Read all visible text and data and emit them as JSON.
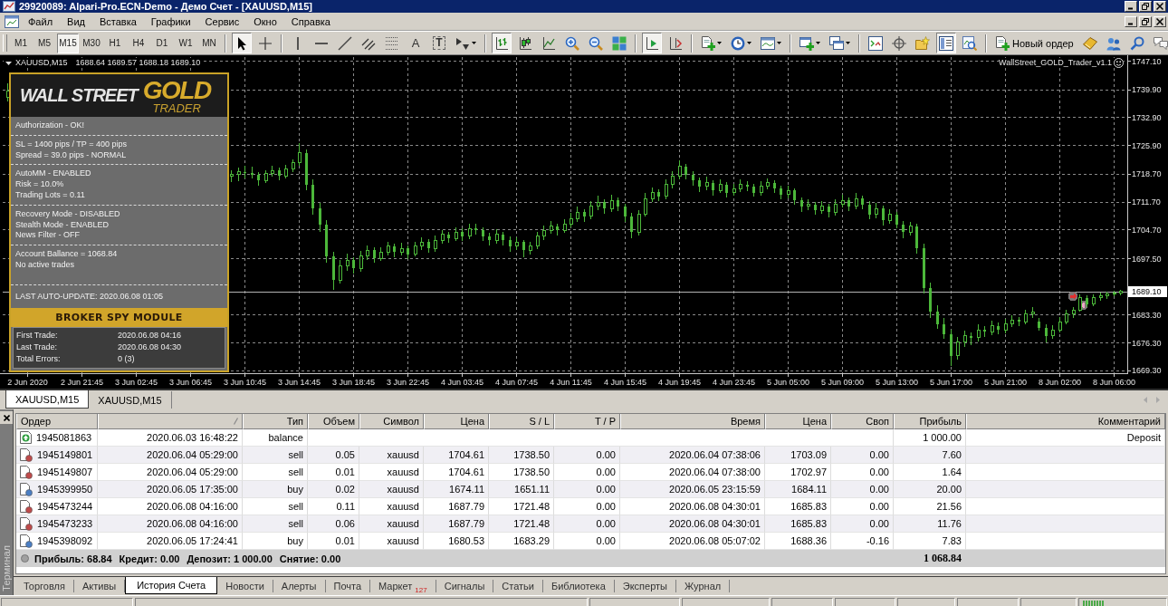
{
  "window": {
    "title": "29920089: Alpari-Pro.ECN-Demo - Демо Счет - [XAUUSD,M15]"
  },
  "menu": [
    "Файл",
    "Вид",
    "Вставка",
    "Графики",
    "Сервис",
    "Окно",
    "Справка"
  ],
  "toolbar": {
    "timeframes": [
      {
        "label": "M1",
        "selected": false
      },
      {
        "label": "M5",
        "selected": false
      },
      {
        "label": "M15",
        "selected": true
      },
      {
        "label": "M30",
        "selected": false
      },
      {
        "label": "H1",
        "selected": false
      },
      {
        "label": "H4",
        "selected": false
      },
      {
        "label": "D1",
        "selected": false
      },
      {
        "label": "W1",
        "selected": false
      },
      {
        "label": "MN",
        "selected": false
      }
    ],
    "groups": [
      [
        {
          "selected": true
        },
        {
          "selected": false
        }
      ],
      [
        {
          "selected": false
        },
        {
          "selected": false
        },
        {
          "selected": false
        },
        {
          "selected": false
        },
        {
          "selected": false
        },
        {
          "selected": false,
          "glyph": "A"
        },
        {
          "selected": false,
          "glyph": "T"
        },
        {
          "selected": false
        }
      ],
      [
        {
          "selected": true
        },
        {
          "selected": false
        },
        {
          "selected": false
        },
        {
          "selected": false
        },
        {
          "selected": false
        },
        {
          "selected": false
        }
      ],
      [
        {
          "selected": true
        },
        {
          "selected": false
        }
      ],
      [
        {
          "selected": false
        },
        {
          "selected": false
        },
        {
          "selected": false
        }
      ],
      [
        {
          "selected": false
        },
        {
          "selected": false
        }
      ],
      [
        {
          "selected": false
        },
        {
          "selected": false
        },
        {
          "selected": false
        },
        {
          "selected": true
        },
        {
          "selected": false
        }
      ],
      [
        {
          "selected": false,
          "label": "Новый ордер"
        },
        {
          "selected": false
        },
        {
          "selected": false
        },
        {
          "selected": false
        },
        {
          "selected": false
        }
      ]
    ]
  },
  "chart": {
    "symbol": "XAUUSD,M15",
    "quote": "1688.64 1689.57 1688.18 1689.10",
    "expert": "WallStreet_GOLD_Trader_v1.1",
    "expert_panel": {
      "logo": {
        "words": "WALL STREET",
        "highlight": "GOLD",
        "subtitle": "TRADER"
      },
      "sections": [
        [
          "Authorization - OK!"
        ],
        [
          "SL = 1400 pips / TP = 400 pips",
          "Spread = 39.0 pips - NORMAL"
        ],
        [
          "AutoMM - ENABLED",
          "Risk = 10.0%",
          "Trading Lots = 0.11"
        ],
        [
          "Recovery Mode - DISABLED",
          "Stealth Mode - ENABLED",
          "News Filter - OFF"
        ],
        [
          "Account Ballance = 1068.84",
          "No active trades"
        ],
        [
          "LAST AUTO-UPDATE: 2020.06.08 01:05"
        ]
      ],
      "module": {
        "title": "BROKER SPY MODULE",
        "rows": [
          {
            "label": "First Trade:",
            "value": "2020.06.08 04:16"
          },
          {
            "label": "Last Trade:",
            "value": "2020.06.08 04:30"
          },
          {
            "label": "Total Errors:",
            "value": "0 (3)"
          }
        ]
      }
    },
    "chart_data": {
      "type": "candlestick",
      "color": "#4cb83a",
      "grid": true,
      "ylim": [
        1668.6,
        1748.0
      ],
      "yticks": [
        {
          "value": 1747.1,
          "label": "1747.10"
        },
        {
          "value": 1739.9,
          "label": "1739.90"
        },
        {
          "value": 1732.9,
          "label": "1732.90"
        },
        {
          "value": 1725.9,
          "label": "1725.90"
        },
        {
          "value": 1718.7,
          "label": "1718.70"
        },
        {
          "value": 1711.7,
          "label": "1711.70"
        },
        {
          "value": 1704.7,
          "label": "1704.70"
        },
        {
          "value": 1697.5,
          "label": "1697.50"
        },
        {
          "value": 1683.3,
          "label": "1683.30"
        },
        {
          "value": 1676.3,
          "label": "1676.30"
        },
        {
          "value": 1669.3,
          "label": "1669.30"
        }
      ],
      "ref_lines": [
        {
          "axis": "y",
          "value": 1689.1,
          "label": "1689.10",
          "color": "#b4b4b4"
        }
      ],
      "categories": [
        null,
        null,
        null,
        "2 Jun 2020",
        null,
        null,
        null,
        null,
        null,
        null,
        null,
        "2 Jun 21:45",
        null,
        null,
        null,
        null,
        null,
        null,
        null,
        "3 Jun 02:45",
        null,
        null,
        null,
        null,
        null,
        null,
        null,
        "3 Jun 06:45",
        null,
        null,
        null,
        null,
        null,
        null,
        null,
        "3 Jun 10:45",
        null,
        null,
        null,
        null,
        null,
        null,
        null,
        "3 Jun 14:45",
        null,
        null,
        null,
        null,
        null,
        null,
        null,
        "3 Jun 18:45",
        null,
        null,
        null,
        null,
        null,
        null,
        null,
        "3 Jun 22:45",
        null,
        null,
        null,
        null,
        null,
        null,
        null,
        "4 Jun 03:45",
        null,
        null,
        null,
        null,
        null,
        null,
        null,
        "4 Jun 07:45",
        null,
        null,
        null,
        null,
        null,
        null,
        null,
        "4 Jun 11:45",
        null,
        null,
        null,
        null,
        null,
        null,
        null,
        "4 Jun 15:45",
        null,
        null,
        null,
        null,
        null,
        null,
        null,
        "4 Jun 19:45",
        null,
        null,
        null,
        null,
        null,
        null,
        null,
        "4 Jun 23:45",
        null,
        null,
        null,
        null,
        null,
        null,
        null,
        "5 Jun 05:00",
        null,
        null,
        null,
        null,
        null,
        null,
        null,
        "5 Jun 09:00",
        null,
        null,
        null,
        null,
        null,
        null,
        null,
        "5 Jun 13:00",
        null,
        null,
        null,
        null,
        null,
        null,
        null,
        "5 Jun 17:00",
        null,
        null,
        null,
        null,
        null,
        null,
        null,
        "5 Jun 21:00",
        null,
        null,
        null,
        null,
        null,
        null,
        null,
        "8 Jun 02:00",
        null,
        null,
        null,
        null,
        null,
        null,
        null,
        "8 Jun 06:00",
        null
      ],
      "ohlc": [
        [
          1738,
          1741.4,
          1736.9,
          1739.5
        ],
        null,
        null,
        null,
        null,
        null,
        null,
        null,
        null,
        null,
        null,
        null,
        null,
        null,
        null,
        null,
        null,
        null,
        null,
        null,
        null,
        null,
        null,
        null,
        null,
        null,
        null,
        null,
        null,
        null,
        null,
        null,
        null,
        [
          1718,
          1719.6,
          1716.6,
          1718.5
        ],
        [
          1718.5,
          1720.2,
          1716.9,
          1719.2
        ],
        [
          1719.2,
          1720.8,
          1717.6,
          1719
        ],
        [
          1719,
          1720.5,
          1717.5,
          1718.5
        ],
        [
          1718.5,
          1719.2,
          1715.8,
          1717
        ],
        [
          1717,
          1719.6,
          1716.4,
          1718.8
        ],
        [
          1718.8,
          1720.6,
          1717.9,
          1719.5
        ],
        [
          1719.5,
          1720.2,
          1717.1,
          1718.2
        ],
        [
          1718.2,
          1721,
          1717.6,
          1720
        ],
        [
          1720,
          1722.4,
          1719.2,
          1721.5
        ],
        [
          1721.5,
          1726.4,
          1720.8,
          1724
        ],
        [
          1724,
          1724.8,
          1714.6,
          1716
        ],
        [
          1716,
          1717.2,
          1708.5,
          1710
        ],
        [
          1710,
          1711.4,
          1704.2,
          1706
        ],
        [
          1706,
          1707,
          1696.4,
          1698
        ],
        [
          1698,
          1699.2,
          1689.5,
          1692
        ],
        [
          1692,
          1697,
          1691.2,
          1695.5
        ],
        [
          1695.5,
          1698.6,
          1694.3,
          1697
        ],
        [
          1697,
          1697.8,
          1693.6,
          1695
        ],
        [
          1695,
          1699.3,
          1694.2,
          1698
        ],
        [
          1698,
          1700.8,
          1697.1,
          1699.5
        ],
        [
          1699.5,
          1700.2,
          1696.4,
          1697.5
        ],
        [
          1697.5,
          1700.3,
          1696.8,
          1699
        ],
        [
          1699,
          1701.6,
          1698.2,
          1700.5
        ],
        [
          1700.5,
          1701.2,
          1697.8,
          1699
        ],
        [
          1699,
          1701.3,
          1698.1,
          1700
        ],
        [
          1700,
          1700.8,
          1697.2,
          1698.5
        ],
        [
          1698.5,
          1701.7,
          1697.9,
          1700.5
        ],
        [
          1700.5,
          1702.8,
          1699.6,
          1701.5
        ],
        [
          1701.5,
          1702.2,
          1698.9,
          1700
        ],
        [
          1700,
          1703.1,
          1699.2,
          1702
        ],
        [
          1702,
          1704.6,
          1701.1,
          1703.5
        ],
        [
          1703.5,
          1704.2,
          1701.4,
          1702.5
        ],
        [
          1702.5,
          1705.3,
          1701.8,
          1704
        ],
        [
          1704,
          1704.9,
          1701.9,
          1703
        ],
        [
          1703,
          1706.2,
          1702.3,
          1705
        ],
        [
          1705,
          1706.1,
          1703.4,
          1704.5
        ],
        [
          1704.5,
          1705.2,
          1701.8,
          1703
        ],
        [
          1703,
          1703.9,
          1700.6,
          1702
        ],
        [
          1702,
          1704.7,
          1701.2,
          1703.5
        ],
        [
          1703.5,
          1704.1,
          1700.8,
          1702
        ],
        [
          1702,
          1702.9,
          1699.2,
          1700.5
        ],
        [
          1700.5,
          1702.8,
          1699.6,
          1701.5
        ],
        [
          1701.5,
          1702.1,
          1697.8,
          1699.5
        ],
        [
          1699.5,
          1701.6,
          1698.4,
          1700.5
        ],
        [
          1700.5,
          1704.2,
          1699.8,
          1703
        ],
        [
          1703,
          1705.6,
          1702.1,
          1704.5
        ],
        [
          1704.5,
          1706.8,
          1703.6,
          1705.5
        ],
        [
          1705.5,
          1706.2,
          1703.2,
          1704.5
        ],
        [
          1704.5,
          1707.3,
          1703.9,
          1706
        ],
        [
          1706,
          1708.8,
          1705.2,
          1707.5
        ],
        [
          1707.5,
          1710.4,
          1706.6,
          1709
        ],
        [
          1709,
          1709.8,
          1706.7,
          1708
        ],
        [
          1708,
          1711.9,
          1707.3,
          1710.5
        ],
        [
          1710.5,
          1713.2,
          1709.6,
          1711.5
        ],
        [
          1711.5,
          1712.3,
          1708.6,
          1710
        ],
        [
          1710,
          1713.4,
          1709.2,
          1712
        ],
        [
          1712,
          1712.8,
          1709.3,
          1710.5
        ],
        [
          1710.5,
          1711.2,
          1706.7,
          1708
        ],
        [
          1708,
          1708.9,
          1702.4,
          1704
        ],
        [
          1704,
          1709.6,
          1703.3,
          1708.5
        ],
        [
          1708.5,
          1713.8,
          1707.9,
          1712.5
        ],
        [
          1712.5,
          1715.3,
          1711.6,
          1714
        ],
        [
          1714,
          1714.9,
          1711.8,
          1713
        ],
        [
          1713,
          1717.2,
          1712.4,
          1716
        ],
        [
          1716,
          1719.3,
          1715.1,
          1718
        ],
        [
          1718,
          1722,
          1717.2,
          1720.5
        ],
        [
          1720.5,
          1721.2,
          1717.4,
          1718.5
        ],
        [
          1718.5,
          1719.4,
          1715.8,
          1717
        ],
        [
          1717,
          1717.8,
          1714.2,
          1715.5
        ],
        [
          1715.5,
          1717.9,
          1714.6,
          1716.5
        ],
        [
          1716.5,
          1717.1,
          1713.3,
          1714.5
        ],
        [
          1714.5,
          1717.2,
          1713.8,
          1716
        ],
        [
          1716,
          1716.7,
          1712.8,
          1714
        ],
        [
          1714,
          1716.2,
          1713.1,
          1715
        ],
        [
          1715,
          1717.3,
          1714.2,
          1716
        ],
        [
          1716,
          1716.9,
          1714.3,
          1715.5
        ],
        [
          1715.5,
          1716.2,
          1712.9,
          1714
        ],
        [
          1714,
          1716.8,
          1713.2,
          1715.5
        ],
        [
          1715.5,
          1717.6,
          1714.7,
          1716.5
        ],
        [
          1716.5,
          1717.1,
          1713.8,
          1715
        ],
        [
          1715,
          1715.8,
          1712.4,
          1713.5
        ],
        [
          1713.5,
          1715.7,
          1712.6,
          1714.5
        ],
        [
          1714.5,
          1715.1,
          1710.9,
          1712
        ],
        [
          1712,
          1712.8,
          1709.2,
          1710.5
        ],
        [
          1710.5,
          1712.3,
          1709.6,
          1711
        ],
        [
          1711,
          1711.7,
          1708.4,
          1709.5
        ],
        [
          1709.5,
          1711.8,
          1708.6,
          1710.5
        ],
        [
          1710.5,
          1711.2,
          1707.8,
          1709
        ],
        [
          1709,
          1712.2,
          1708.3,
          1711
        ],
        [
          1711,
          1713.4,
          1710.2,
          1712
        ],
        [
          1712,
          1712.8,
          1709.4,
          1710.5
        ],
        [
          1710.5,
          1713.8,
          1709.7,
          1712.5
        ],
        [
          1712.5,
          1713.2,
          1709.8,
          1711
        ],
        [
          1711,
          1711.9,
          1707.2,
          1708.5
        ],
        [
          1708.5,
          1711.3,
          1707.6,
          1710
        ],
        [
          1710,
          1710.8,
          1705.8,
          1707
        ],
        [
          1707,
          1709.7,
          1706.1,
          1708.5
        ],
        [
          1708.5,
          1709.2,
          1704.9,
          1706
        ],
        [
          1706,
          1706.8,
          1702.6,
          1704
        ],
        [
          1704,
          1706.6,
          1703.1,
          1705.5
        ],
        [
          1705.5,
          1706.2,
          1698.7,
          1700
        ],
        [
          1700,
          1701.1,
          1688.6,
          1690
        ],
        [
          1690,
          1691.3,
          1682.4,
          1684
        ],
        [
          1684,
          1685.6,
          1679.8,
          1681
        ],
        [
          1681,
          1682.4,
          1677.2,
          1678.5
        ],
        [
          1678.5,
          1679.6,
          1670.4,
          1673
        ],
        [
          1673,
          1677.8,
          1672.1,
          1676.5
        ],
        [
          1676.5,
          1679.2,
          1675.3,
          1678
        ],
        [
          1678,
          1678.9,
          1675.6,
          1677.5
        ],
        [
          1677.5,
          1680.8,
          1676.6,
          1679.5
        ],
        [
          1679.5,
          1680.4,
          1677.8,
          1679
        ],
        [
          1679,
          1681.7,
          1678.2,
          1680.5
        ],
        [
          1680.5,
          1681.3,
          1678.4,
          1679.5
        ],
        [
          1679.5,
          1682.2,
          1678.7,
          1681
        ],
        [
          1681,
          1683.1,
          1680.2,
          1682
        ],
        [
          1682,
          1682.8,
          1680.4,
          1681.5
        ],
        [
          1681.5,
          1684.6,
          1680.8,
          1683.5
        ],
        [
          1683.5,
          1685.2,
          1682.6,
          1684
        ],
        [
          1681.5,
          1682.4,
          1679.2,
          1680
        ],
        [
          1680,
          1680.8,
          1676.4,
          1678
        ],
        [
          1678,
          1680.6,
          1677.2,
          1679.5
        ],
        [
          1679.5,
          1682.7,
          1678.8,
          1681.5
        ],
        [
          1681.5,
          1684.6,
          1680.9,
          1683.5
        ],
        [
          1683.5,
          1685.3,
          1682.4,
          1684.5
        ],
        [
          1684.5,
          1688.4,
          1684,
          1687.5
        ],
        [
          1687.5,
          1688.2,
          1685.3,
          1686
        ],
        [
          1686,
          1688.4,
          1685.4,
          1687.5
        ],
        [
          1687.5,
          1688.9,
          1686.8,
          1688
        ],
        [
          1688,
          1689.2,
          1687.3,
          1688.6
        ],
        [
          1688.6,
          1689.3,
          1687.9,
          1688.64
        ],
        [
          1688.64,
          1689.57,
          1688.18,
          1689.1
        ]
      ]
    }
  },
  "chart_tabs": [
    {
      "label": "XAUUSD,M15",
      "selected": true
    },
    {
      "label": "XAUUSD,M15",
      "selected": false
    }
  ],
  "terminal": {
    "title": "Терминал",
    "columns": [
      {
        "title": "Ордер",
        "sorted": false
      },
      {
        "sorted": true
      },
      {
        "title": "Тип",
        "sorted": false
      },
      {
        "title": "Объем",
        "sorted": false
      },
      {
        "title": "Символ",
        "sorted": false
      },
      {
        "title": "Цена",
        "sorted": false
      },
      {
        "title": "S / L",
        "sorted": false
      },
      {
        "title": "T / P",
        "sorted": false
      },
      {
        "title": "Время",
        "sorted": false
      },
      {
        "title": "Цена",
        "sorted": false
      },
      {
        "title": "Своп",
        "sorted": false
      },
      {
        "title": "Прибыль",
        "sorted": false
      },
      {
        "title": "Комментарий",
        "sorted": false
      }
    ],
    "rows": [
      {
        "kind": "balance",
        "cells": [
          "1945081863",
          "2020.06.03 16:48:22",
          "balance",
          null,
          null,
          null,
          null,
          null,
          null,
          null,
          null,
          "1 000.00",
          "Deposit"
        ]
      },
      {
        "kind": "sell",
        "cells": [
          "1945149801",
          "2020.06.04 05:29:00",
          "sell",
          "0.05",
          "xauusd",
          "1704.61",
          "1738.50",
          "0.00",
          "2020.06.04 07:38:06",
          "1703.09",
          "0.00",
          "7.60",
          null
        ]
      },
      {
        "kind": "sell",
        "cells": [
          "1945149807",
          "2020.06.04 05:29:00",
          "sell",
          "0.01",
          "xauusd",
          "1704.61",
          "1738.50",
          "0.00",
          "2020.06.04 07:38:00",
          "1702.97",
          "0.00",
          "1.64",
          null
        ]
      },
      {
        "kind": "buy",
        "cells": [
          "1945399950",
          "2020.06.05 17:35:00",
          "buy",
          "0.02",
          "xauusd",
          "1674.11",
          "1651.11",
          "0.00",
          "2020.06.05 23:15:59",
          "1684.11",
          "0.00",
          "20.00",
          null
        ]
      },
      {
        "kind": "sell",
        "cells": [
          "1945473244",
          "2020.06.08 04:16:00",
          "sell",
          "0.11",
          "xauusd",
          "1687.79",
          "1721.48",
          "0.00",
          "2020.06.08 04:30:01",
          "1685.83",
          "0.00",
          "21.56",
          null
        ]
      },
      {
        "kind": "sell",
        "cells": [
          "1945473233",
          "2020.06.08 04:16:00",
          "sell",
          "0.06",
          "xauusd",
          "1687.79",
          "1721.48",
          "0.00",
          "2020.06.08 04:30:01",
          "1685.83",
          "0.00",
          "11.76",
          null
        ]
      },
      {
        "kind": "buy",
        "cells": [
          "1945398092",
          "2020.06.05 17:24:41",
          "buy",
          "0.01",
          "xauusd",
          "1680.53",
          "1683.29",
          "0.00",
          "2020.06.08 05:07:02",
          "1688.36",
          "-0.16",
          "7.83",
          null
        ]
      }
    ],
    "totals": [
      "Прибыль: 68.84",
      "Кредит: 0.00",
      "Депозит: 1 000.00",
      "Снятие: 0.00"
    ],
    "balance": "1 068.84",
    "tabs": [
      {
        "label": "Торговля",
        "selected": false
      },
      {
        "label": "Активы",
        "selected": false
      },
      {
        "label": "История Счета",
        "selected": true
      },
      {
        "label": "Новости",
        "selected": false
      },
      {
        "label": "Алерты",
        "selected": false
      },
      {
        "label": "Почта",
        "selected": false
      },
      {
        "label": "Маркет",
        "badge": "127",
        "selected": false
      },
      {
        "label": "Сигналы",
        "selected": false
      },
      {
        "label": "Статьи",
        "selected": false
      },
      {
        "label": "Библиотека",
        "selected": false
      },
      {
        "label": "Эксперты",
        "selected": false
      },
      {
        "label": "Журнал",
        "selected": false
      }
    ]
  }
}
